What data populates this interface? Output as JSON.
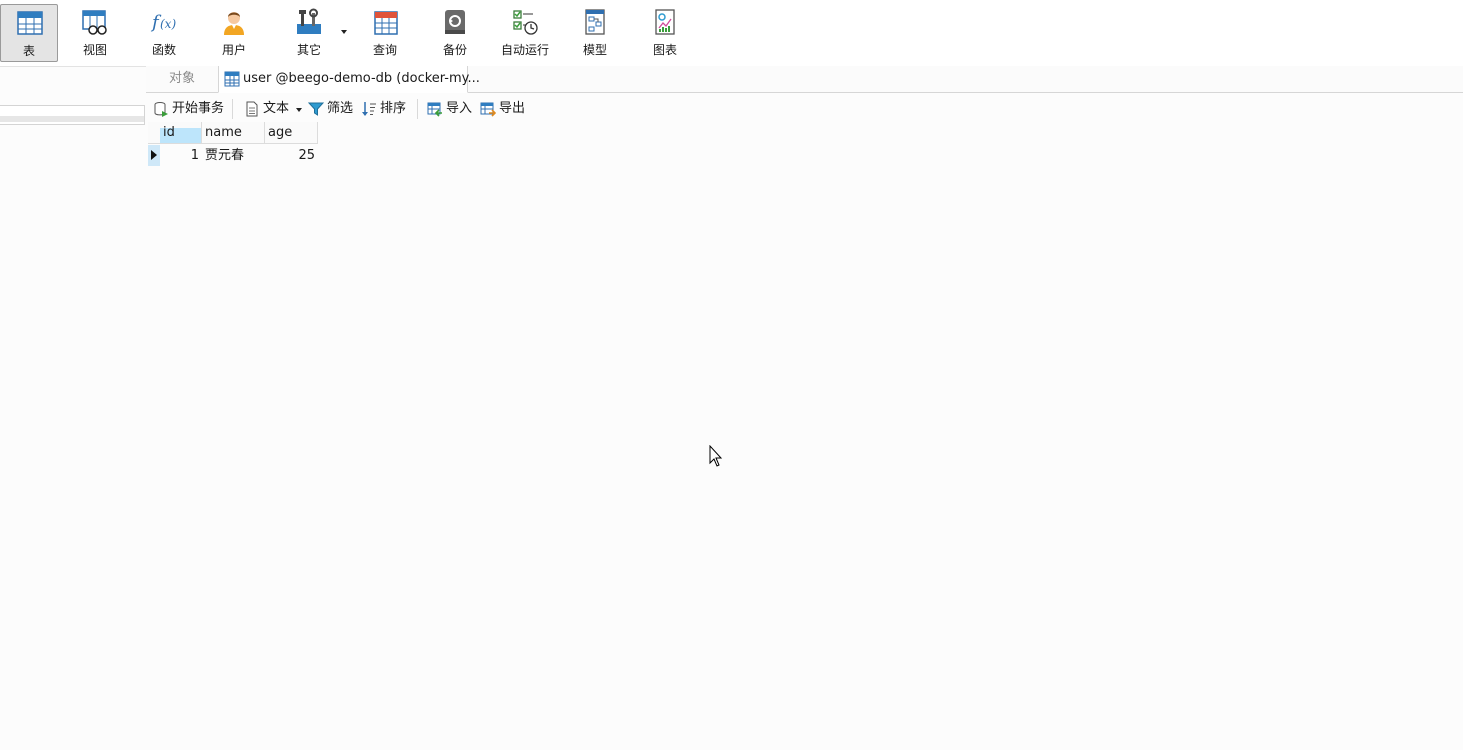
{
  "ribbon": {
    "items": [
      {
        "label": "表",
        "icon": "table-icon",
        "active": true
      },
      {
        "label": "视图",
        "icon": "view-icon"
      },
      {
        "label": "函数",
        "icon": "function-icon"
      },
      {
        "label": "用户",
        "icon": "user-icon"
      },
      {
        "label": "其它",
        "icon": "tools-icon"
      },
      {
        "label": "查询",
        "icon": "query-icon"
      },
      {
        "label": "备份",
        "icon": "backup-icon"
      },
      {
        "label": "自动运行",
        "icon": "automation-icon"
      },
      {
        "label": "模型",
        "icon": "model-icon"
      },
      {
        "label": "图表",
        "icon": "chart-icon"
      }
    ]
  },
  "tabs": {
    "objects": "对象",
    "table_tab": "user @beego-demo-db (docker-my..."
  },
  "toolbar": {
    "begin_transaction": "开始事务",
    "text": "文本",
    "filter": "筛选",
    "sort": "排序",
    "import": "导入",
    "export": "导出"
  },
  "grid": {
    "columns": [
      "id",
      "name",
      "age"
    ],
    "rows": [
      [
        "1",
        "贾元春",
        "25"
      ]
    ]
  },
  "colors": {
    "accent_blue": "#2f7dc0",
    "selection": "#bde5fb"
  }
}
